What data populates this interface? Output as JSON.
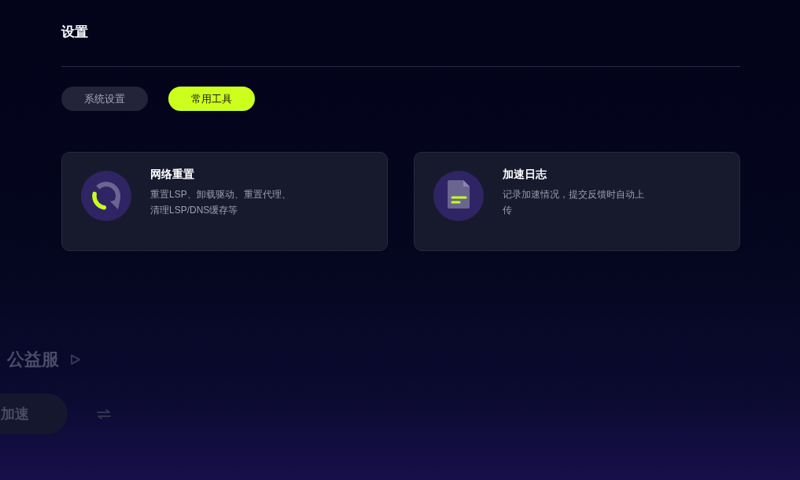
{
  "title": "设置",
  "tabs": [
    {
      "label": "系统设置",
      "selected": false
    },
    {
      "label": "常用工具",
      "selected": true
    }
  ],
  "tools": [
    {
      "kind": "reset",
      "title": "网络重置",
      "description": "重置LSP、卸载驱动、重置代理、清理LSP/DNS缓存等"
    },
    {
      "kind": "log",
      "title": "加速日志",
      "description": "记录加速情况，提交反馈时自动上传"
    }
  ],
  "backdrop": {
    "heading": "公益服",
    "accelerate_button": "加速"
  }
}
